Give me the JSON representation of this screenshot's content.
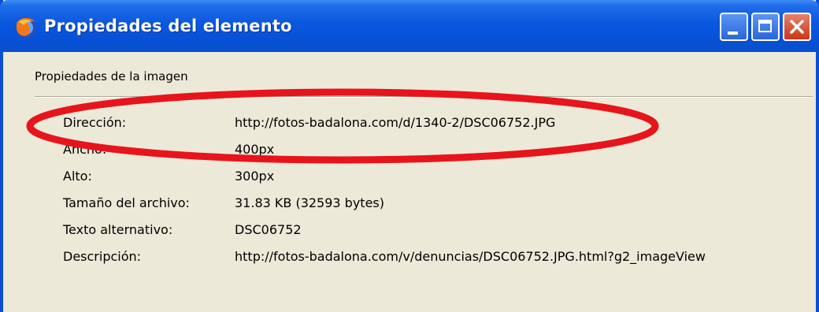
{
  "window": {
    "title": "Propiedades del elemento"
  },
  "section": {
    "label": "Propiedades de la imagen"
  },
  "properties": [
    {
      "label": "Dirección:",
      "value": "http://fotos-badalona.com/d/1340-2/DSC06752.JPG"
    },
    {
      "label": "Ancho:",
      "value": "400px"
    },
    {
      "label": "Alto:",
      "value": "300px"
    },
    {
      "label": "Tamaño del archivo:",
      "value": "31.83 KB (32593 bytes)"
    },
    {
      "label": "Texto alternativo:",
      "value": "DSC06752"
    },
    {
      "label": "Descripción:",
      "value": "http://fotos-badalona.com/v/denuncias/DSC06752.JPG.html?g2_imageView"
    }
  ],
  "colors": {
    "titlebar": "#0a57e0",
    "annotation": "#e8141b",
    "background": "#ece9d8"
  },
  "icons": {
    "app": "firefox-icon"
  }
}
